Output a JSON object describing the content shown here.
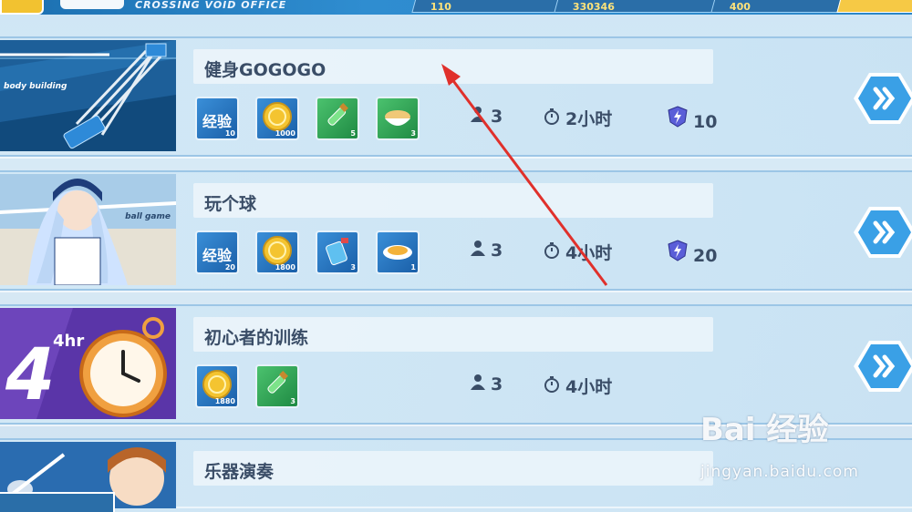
{
  "header": {
    "office_label": "CROSSING VOID OFFICE",
    "resources": [
      {
        "icon": "arrow-icon",
        "value": "110"
      },
      {
        "icon": "coin-icon",
        "value": "330346"
      },
      {
        "icon": "gem-icon",
        "value": "400"
      },
      {
        "icon": "plus-icon",
        "value": ""
      }
    ]
  },
  "tasks": [
    {
      "title": "健身GOGOGO",
      "thumb_label": "body building",
      "rewards": [
        {
          "icon": "exp-icon",
          "label": "经验",
          "count": "10",
          "color": "blue"
        },
        {
          "icon": "gold-coin-icon",
          "label": "",
          "count": "1000",
          "color": "blue"
        },
        {
          "icon": "green-bottle-icon",
          "label": "",
          "count": "5",
          "color": "green"
        },
        {
          "icon": "food-bowl-icon",
          "label": "",
          "count": "3",
          "color": "green"
        }
      ],
      "people": "3",
      "time": "2小时",
      "energy": "10"
    },
    {
      "title": "玩个球",
      "thumb_label": "ball game",
      "rewards": [
        {
          "icon": "exp-icon",
          "label": "经验",
          "count": "20",
          "color": "blue"
        },
        {
          "icon": "gold-coin-icon",
          "label": "",
          "count": "1800",
          "color": "blue"
        },
        {
          "icon": "water-bottle-icon",
          "label": "",
          "count": "3",
          "color": "blue"
        },
        {
          "icon": "food-plate-icon",
          "label": "",
          "count": "1",
          "color": "blue"
        }
      ],
      "people": "3",
      "time": "4小时",
      "energy": "20"
    },
    {
      "title": "初心者的训练",
      "thumb_label": "4hr",
      "rewards": [
        {
          "icon": "gold-coin-icon",
          "label": "",
          "count": "1880",
          "color": "blue"
        },
        {
          "icon": "green-bottle-icon",
          "label": "",
          "count": "3",
          "color": "green"
        }
      ],
      "people": "3",
      "time": "4小时",
      "energy": ""
    },
    {
      "title": "乐器演奏",
      "thumb_label": "",
      "rewards": [],
      "people": "",
      "time": "",
      "energy": ""
    }
  ],
  "watermark": {
    "main": "Bai 经验",
    "sub": "jingyan.baidu.com"
  },
  "colors": {
    "accent": "#2f8dd0",
    "text": "#3a4d67",
    "button": "#3aa0e6",
    "arrow": "#e0302b"
  }
}
